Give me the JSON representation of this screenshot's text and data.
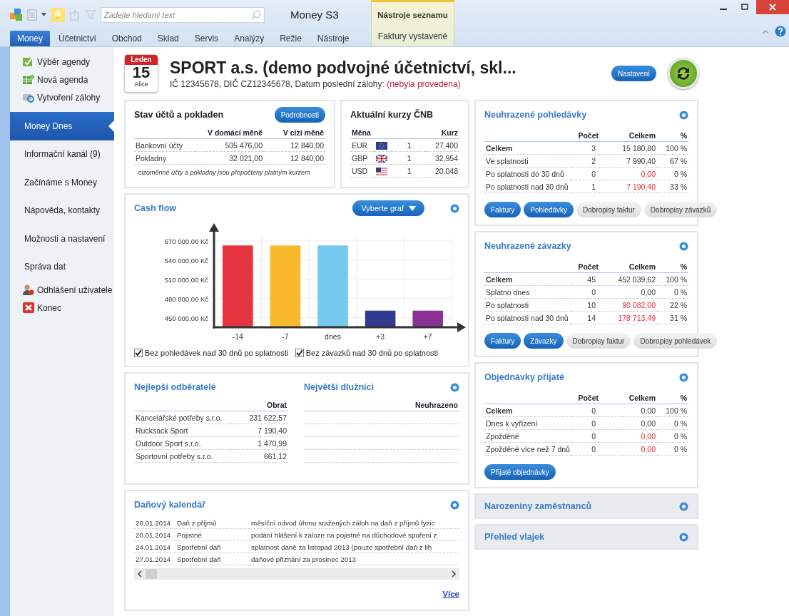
{
  "titlebar": {
    "search_placeholder": "Zadejte hledaný text",
    "title": "Money S3",
    "context_group": "Nástroje seznamu"
  },
  "ribbon_tabs": [
    {
      "label": "Money",
      "selected": true
    },
    {
      "label": "Účetnictví",
      "selected": false
    },
    {
      "label": "Obchod",
      "selected": false
    },
    {
      "label": "Sklad",
      "selected": false
    },
    {
      "label": "Servis",
      "selected": false
    },
    {
      "label": "Analýzy",
      "selected": false
    },
    {
      "label": "Režie",
      "selected": false
    },
    {
      "label": "Nástroje",
      "selected": false
    }
  ],
  "context_tab": {
    "label": "Faktury vystavené",
    "selected": false
  },
  "sidebar": {
    "top_actions": [
      {
        "label": "Výběr agendy"
      },
      {
        "label": "Nová agenda"
      },
      {
        "label": "Vytvoření zálohy"
      }
    ],
    "items": [
      {
        "label": "Money Dnes",
        "selected": true
      },
      {
        "label": "Informační kanál (9)",
        "selected": false
      },
      {
        "label": "Začínáme s Money",
        "selected": false
      },
      {
        "label": "Nápověda, kontakty",
        "selected": false
      },
      {
        "label": "Možnosti a nastavení",
        "selected": false
      },
      {
        "label": "Správa dat",
        "selected": false
      }
    ],
    "bottom_actions": [
      {
        "label": "Odhlášení uživatele"
      },
      {
        "label": "Konec"
      }
    ]
  },
  "header": {
    "month": "Leden",
    "day": "15",
    "user": "Alice",
    "company": "SPORT a.s. (demo podvojné účetnictví, skl...",
    "info": "IČ 12345678, DIČ CZ12345678, Datum poslední zálohy: ",
    "backup_status": "(nebyla provedena)",
    "settings_button": "Nastavení"
  },
  "accounts": {
    "title": "Stav účtů a pokladen",
    "button": "Podrobnosti",
    "columns": [
      "V domácí měně",
      "V cizí měně"
    ],
    "rows": [
      {
        "label": "Bankovní účty",
        "domestic": "505 476,00",
        "foreign": "12 840,00"
      },
      {
        "label": "Pokladny",
        "domestic": "32 021,00",
        "foreign": "12 840,00"
      }
    ],
    "note": "cizoměnné účty a pokladny jsou přepočteny platným kurzem"
  },
  "rates": {
    "title": "Aktuální kurzy ČNB",
    "columns": [
      "Měna",
      "Kurz"
    ],
    "rows": [
      {
        "code": "EUR",
        "amount": "1",
        "rate": "27,400"
      },
      {
        "code": "GBP",
        "amount": "1",
        "rate": "32,954"
      },
      {
        "code": "USD",
        "amount": "1",
        "rate": "20,048"
      }
    ]
  },
  "cashflow": {
    "title": "Cash flow",
    "select_button": "Vyberte graf",
    "chart_data": {
      "type": "bar",
      "categories": [
        "-14",
        "-7",
        "dnes",
        "+3",
        "+7"
      ],
      "series": [
        {
          "color": "#e53540",
          "values": [
            563000,
            null,
            null,
            null,
            null
          ]
        },
        {
          "color": "#f9b92c",
          "values": [
            null,
            563000,
            null,
            null,
            null
          ]
        },
        {
          "color": "#76c9ef",
          "values": [
            null,
            null,
            563000,
            null,
            null
          ]
        },
        {
          "color": "#303a8e",
          "values": [
            null,
            null,
            null,
            461000,
            null
          ]
        },
        {
          "color": "#8a3291",
          "values": [
            null,
            null,
            null,
            null,
            461000
          ]
        }
      ],
      "stacked": true,
      "grid": true,
      "ylim": [
        435000,
        580000
      ],
      "yticks": [
        {
          "value": 450000,
          "label": "450 000,00 Kč"
        },
        {
          "value": 480000,
          "label": "480 000,00 Kč"
        },
        {
          "value": 510000,
          "label": "510 000,00 Kč"
        },
        {
          "value": 540000,
          "label": "540 000,00 Kč"
        },
        {
          "value": 570000,
          "label": "570 000,00 Kč"
        }
      ]
    },
    "checkboxes": [
      {
        "label": "Bez pohledávek nad 30 dnů po splatnosti",
        "checked": true
      },
      {
        "label": "Bez závazků nad 30 dnů po splatnosti",
        "checked": true
      }
    ]
  },
  "customers": {
    "title": "Nejlepší odběratelé",
    "column": "Obrat",
    "rows": [
      {
        "name": "Kancelářské potřeby s.r.o.",
        "value": "231 622,57"
      },
      {
        "name": "Rucksack Sport",
        "value": "7 190,40"
      },
      {
        "name": "Outdoor Sport s.r.o.",
        "value": "1 470,99"
      },
      {
        "name": "Sportovní potřeby s.r.o.",
        "value": "661,12"
      }
    ]
  },
  "debtors": {
    "title": "Největší dlužníci",
    "column": "Neuhrazeno"
  },
  "tax_calendar": {
    "title": "Daňový kalendář",
    "link": "Více",
    "rows": [
      {
        "date": "20.01.2014",
        "type": "Daň z příjmů",
        "description": "měsíční odvod úhrnu sražených záloh na daň z příjmů fyzic"
      },
      {
        "date": "20.01.2014",
        "type": "Pojistné",
        "description": "podání hlášení k záloze na pojistné na důchodové spoření z"
      },
      {
        "date": "24.01.2014",
        "type": "Spotřební daň",
        "description": "splatnost daně za listopad 2013 (pouze spotřební daň z lih"
      },
      {
        "date": "27.01.2014",
        "type": "Spotřební daň",
        "description": "daňové přiznání za prosinec 2013"
      }
    ]
  },
  "summary_panels": [
    {
      "title": "Neuhrazené pohledávky",
      "columns": [
        "Počet",
        "Celkem",
        "%"
      ],
      "rows": [
        {
          "label": "Celkem",
          "count": "3",
          "total": "15 180,80",
          "percent": "100 %",
          "bold": true,
          "alert": false
        },
        {
          "label": "Ve splatnosti",
          "count": "2",
          "total": "7 990,40",
          "percent": "67 %",
          "bold": false,
          "alert": false
        },
        {
          "label": "Po splatnosti do 30 dnů",
          "count": "0",
          "total": "0,00",
          "percent": "0 %",
          "bold": false,
          "alert": true
        },
        {
          "label": "Po splatnosti nad 30 dnů",
          "count": "1",
          "total": "7 190,40",
          "percent": "33 %",
          "bold": false,
          "alert": true
        }
      ],
      "buttons": [
        {
          "label": "Faktury",
          "kind": "primary"
        },
        {
          "label": "Pohledávky",
          "kind": "primary"
        },
        {
          "label": "Dobropisy faktur",
          "kind": "secondary"
        },
        {
          "label": "Dobropisy závazků",
          "kind": "secondary"
        }
      ]
    },
    {
      "title": "Neuhrazené závazky",
      "columns": [
        "Počet",
        "Celkem",
        "%"
      ],
      "rows": [
        {
          "label": "Celkem",
          "count": "45",
          "total": "452 039,62",
          "percent": "100 %",
          "bold": true,
          "alert": false
        },
        {
          "label": "Splatno dnes",
          "count": "0",
          "total": "0,00",
          "percent": "0 %",
          "bold": false,
          "alert": false
        },
        {
          "label": "Po splatnosti",
          "count": "10",
          "total": "90 082,00",
          "percent": "22 %",
          "bold": false,
          "alert": true
        },
        {
          "label": "Po splatnosti nad 30 dnů",
          "count": "14",
          "total": "178 713,49",
          "percent": "31 %",
          "bold": false,
          "alert": true
        }
      ],
      "buttons": [
        {
          "label": "Faktury",
          "kind": "primary"
        },
        {
          "label": "Závazky",
          "kind": "primary"
        },
        {
          "label": "Dobropisy faktur",
          "kind": "secondary"
        },
        {
          "label": "Dobropisy pohledávek",
          "kind": "secondary"
        }
      ]
    },
    {
      "title": "Objednávky přijaté",
      "columns": [
        "Počet",
        "Celkem",
        "%"
      ],
      "rows": [
        {
          "label": "Celkem",
          "count": "0",
          "total": "0,00",
          "percent": "100 %",
          "bold": true,
          "alert": false
        },
        {
          "label": "Dnes k vyřízení",
          "count": "0",
          "total": "0,00",
          "percent": "0 %",
          "bold": false,
          "alert": false
        },
        {
          "label": "Zpožděné",
          "count": "0",
          "total": "0,00",
          "percent": "0 %",
          "bold": false,
          "alert": true
        },
        {
          "label": "Zpožděné více než 7 dnů",
          "count": "0",
          "total": "0,00",
          "percent": "0 %",
          "bold": false,
          "alert": true
        }
      ],
      "buttons": [
        {
          "label": "Přijaté objednávky",
          "kind": "primary"
        }
      ]
    }
  ],
  "collapsed_panels": [
    {
      "title": "Narozeniny zaměstnanců",
      "expanded": false
    },
    {
      "title": "Přehled vlajek",
      "expanded": false
    }
  ]
}
